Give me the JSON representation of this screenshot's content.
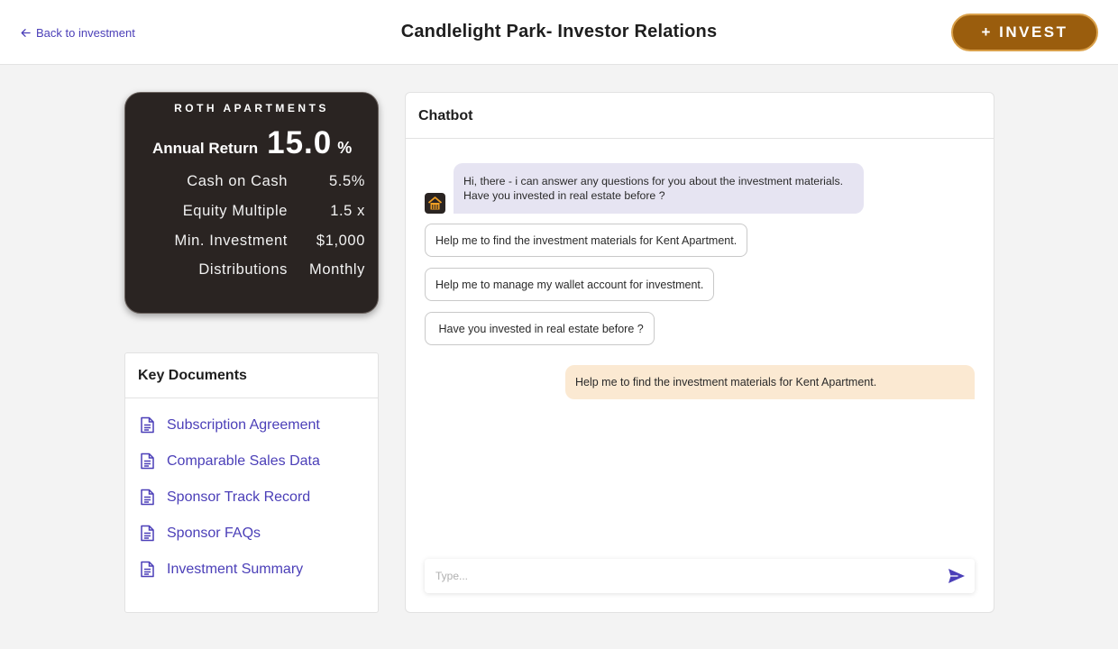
{
  "header": {
    "back_label": "Back to investment",
    "title": "Candlelight Park- Investor Relations",
    "invest_label": "+ INVEST",
    "accent_color": "#9a5d0d"
  },
  "stats": {
    "brand": "ROTH APARTMENTS",
    "annual_label": "Annual Return",
    "annual_value": "15.0",
    "annual_unit": "%",
    "rows": [
      {
        "label": "Cash on Cash",
        "value": "5.5%"
      },
      {
        "label": "Equity Multiple",
        "value": "1.5 x"
      },
      {
        "label": "Min. Investment",
        "value": "$1,000"
      },
      {
        "label": "Distributions",
        "value": "Monthly"
      }
    ]
  },
  "documents": {
    "title": "Key Documents",
    "icon": "document-icon",
    "items": [
      "Subscription Agreement",
      "Comparable Sales Data",
      "Sponsor Track Record",
      "Sponsor FAQs",
      "Investment Summary"
    ]
  },
  "chat": {
    "title": "Chatbot",
    "bot_message": "Hi, there -  i can answer  any questions for you about the investment materials. Have you invested in real estate before ?",
    "suggestions": [
      "Help me to find the investment materials for Kent Apartment.",
      "Help me to manage my wallet account for investment.",
      " Have you invested in real estate before ?"
    ],
    "user_message": "Help me to find the investment materials for Kent Apartment.",
    "input_placeholder": "Type...",
    "input_value": "",
    "send_icon": "send-icon",
    "bot_avatar_icon": "building-icon"
  }
}
